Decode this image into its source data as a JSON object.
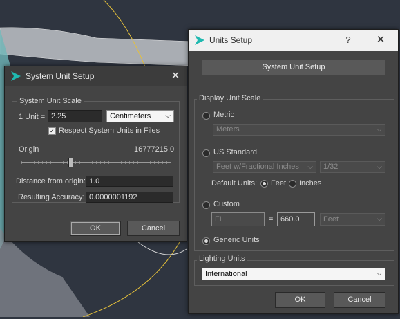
{
  "colors": {
    "viewport_bg": "#2f3540",
    "dialog_bg": "#444444",
    "accent_icon": "#1fb9b0"
  },
  "system_unit_setup": {
    "title": "System Unit Setup",
    "group_label": "System Unit Scale",
    "unit_label": "1 Unit =",
    "unit_value": "2.25",
    "unit_type": "Centimeters",
    "respect_label": "Respect System Units in Files",
    "respect_checked": true,
    "origin_label": "Origin",
    "origin_value": "16777215.0",
    "distance_label": "Distance from origin:",
    "distance_value": "1.0",
    "accuracy_label": "Resulting Accuracy:",
    "accuracy_value": "0.0000001192",
    "ok_label": "OK",
    "cancel_label": "Cancel",
    "close_glyph": "✕"
  },
  "units_setup": {
    "title": "Units Setup",
    "help_glyph": "?",
    "close_glyph": "✕",
    "system_button": "System Unit Setup",
    "display_group": "Display Unit Scale",
    "metric_label": "Metric",
    "metric_value": "Meters",
    "us_label": "US Standard",
    "us_value": "Feet w/Fractional Inches",
    "us_fraction": "1/32",
    "default_units_label": "Default Units:",
    "feet_label": "Feet",
    "inches_label": "Inches",
    "custom_label": "Custom",
    "custom_name": "FL",
    "custom_equals": "=",
    "custom_value": "660.0",
    "custom_unit": "Feet",
    "generic_label": "Generic Units",
    "selected_option": "Generic Units",
    "lighting_group": "Lighting Units",
    "lighting_value": "International",
    "ok_label": "OK",
    "cancel_label": "Cancel"
  }
}
